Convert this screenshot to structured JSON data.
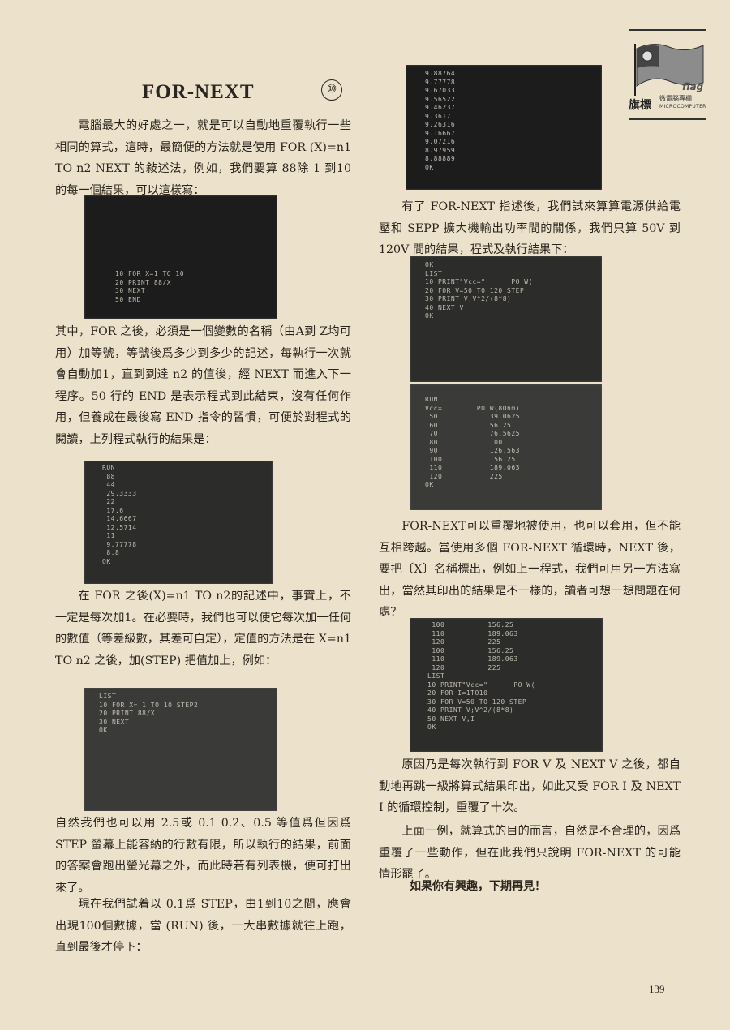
{
  "header": {
    "title": "FOR-NEXT",
    "issue_number": "⑩"
  },
  "logo": {
    "flag_word": "flag",
    "main": "旗標",
    "sub": "微電腦專欄",
    "sub_en": "MICROCOMPUTER"
  },
  "left_column": {
    "p1": "電腦最大的好處之一，就是可以自動地重覆執行一些相同的算式，這時，最簡便的方法就是使用 FOR (X)=n1 TO n2 NEXT 的敍述法，例如，我們要算 88除 1 到10的每一個結果，可以這樣寫：",
    "p2": "其中，FOR 之後，必須是一個變數的名稱（由A到 Z均可用）加等號，等號後爲多少到多少的記述，每執行一次就會自動加1，直到到達 n2 的值後，經 NEXT 而進入下一程序。50 行的 END 是表示程式到此結束，沒有任何作用，但養成在最後寫 END 指令的習慣，可便於對程式的閱讀，上列程式執行的結果是：",
    "p3": "在 FOR 之後(X)=n1 TO n2的記述中，事實上，不一定是每次加1。在必要時，我們也可以使它每次加一任何的數值（等差級數，其差可自定），定值的方法是在 X=n1 TO n2 之後，加(STEP) 把值加上，例如：",
    "p4": "自然我們也可以用 2.5或 0.1 0.2、0.5 等值爲但因爲 STEP 螢幕上能容納的行數有限，所以執行的結果，前面的答案會跑出螢光幕之外，而此時若有列表機，便可打出來了。",
    "p5": "現在我們試着以 0.1爲 STEP，由1到10之間，應會出現100個數據，當 (RUN) 後，一大串數據就往上跑，直到最後才停下："
  },
  "right_column": {
    "p1": "有了 FOR-NEXT 指述後，我們試來算算電源供給電壓和 SEPP 擴大機輸出功率間的關係，我們只算 50V 到 120V 間的結果，程式及執行結果下：",
    "p2": "FOR-NEXT可以重覆地被使用，也可以套用，但不能互相跨越。當使用多個 FOR-NEXT 循環時，NEXT 後，要把〔X〕名稱標出，例如上一程式，我們可用另一方法寫出，當然其印出的結果是不一樣的，讀者可想一想問題在何處？",
    "p3": "原因乃是每次執行到 FOR V 及 NEXT V 之後，都自動地再跳一級將算式結果印出，如此又受 FOR I 及 NEXT I 的循環控制，重覆了十次。",
    "p4": "上面一例，就算式的目的而言，自然是不合理的，因爲重覆了一些動作，但在此我們只說明 FOR-NEXT 的可能情形罷了。",
    "closing": "如果你有興趣，下期再見！"
  },
  "screens": {
    "s1": "10 FOR X=1 TO 10\n20 PRINT 88/X\n30 NEXT\n50 END",
    "s2": "RUN\n 88\n 44\n 29.3333\n 22\n 17.6\n 14.6667\n 12.5714\n 11\n 9.77778\n 8.8\nOK",
    "s3": "LIST\n10 FOR X= 1 TO 10 STEP2\n20 PRINT 88/X\n30 NEXT\nOK",
    "s4": "9.88764\n9.77778\n9.67033\n9.56522\n9.46237\n9.3617\n9.26316\n9.16667\n9.07216\n8.97959\n8.88889\nOK",
    "s5": "OK\nLIST\n10 PRINT\"Vcc=\"      PO W(\n20 FOR V=50 TO 120 STEP\n30 PRINT V;V^2/(8*8)\n40 NEXT V\nOK",
    "s6": "RUN\nVcc=        PO W(8Ohm)\n 50            39.0625\n 60            56.25\n 70            76.5625\n 80            100\n 90            126.563\n 100           156.25\n 110           189.063\n 120           225\nOK",
    "s7": " 100          156.25\n 110          189.063\n 120          225\n 100          156.25\n 110          189.063\n 120          225\nLIST\n10 PRINT\"Vcc=\"      PO W(\n20 FOR I=1TO10\n30 FOR V=50 TO 120 STEP\n40 PRINT V;V^2/(8*8)\n50 NEXT V,I\nOK"
  },
  "page_number": "139"
}
